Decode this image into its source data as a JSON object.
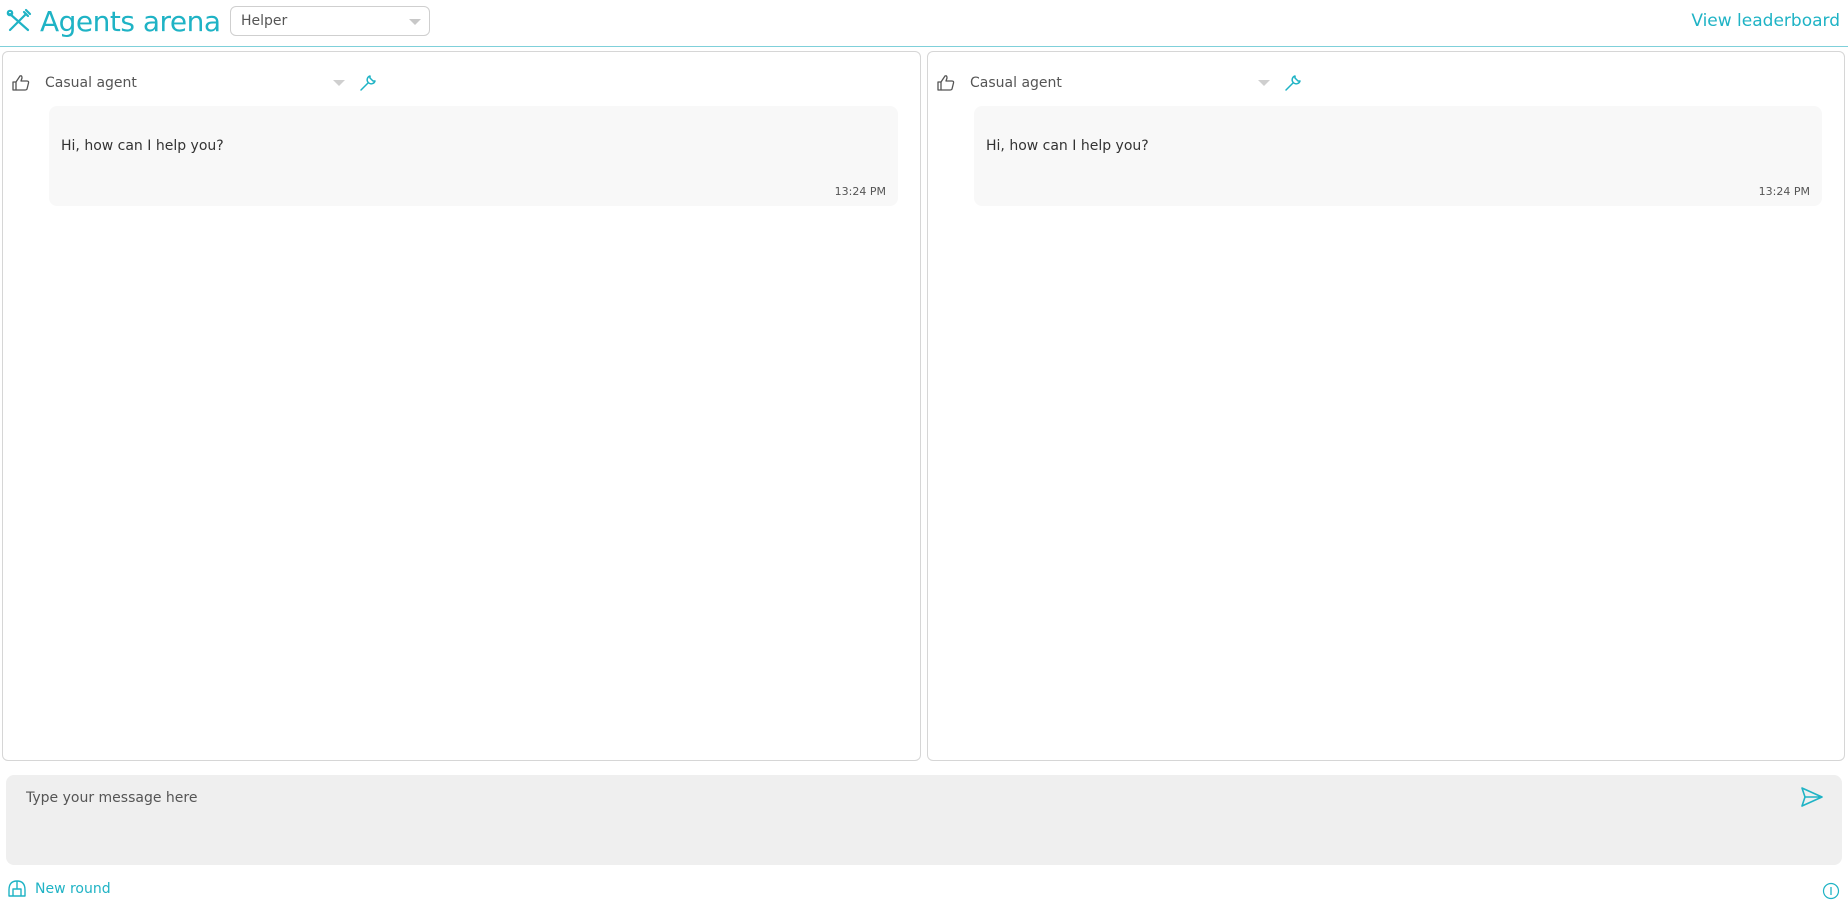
{
  "header": {
    "brand_title": "Agents arena",
    "brand_icon": "crossed-tools-icon",
    "agent_select_value": "Helper",
    "leaderboard_link": "View leaderboard"
  },
  "panels": [
    {
      "model_name": "Casual agent",
      "messages": [
        {
          "text": "Hi, how can I help you?",
          "time": "13:24 PM"
        }
      ]
    },
    {
      "model_name": "Casual agent",
      "messages": [
        {
          "text": "Hi, how can I help you?",
          "time": "13:24 PM"
        }
      ]
    }
  ],
  "composer": {
    "placeholder": "Type your message here",
    "value": ""
  },
  "footer": {
    "new_round_label": "New round"
  },
  "colors": {
    "accent": "#1fb3c5",
    "panel_border": "#d6d6d6",
    "composer_bg": "#efefef",
    "message_bg": "#f8f8f8"
  },
  "icons": {
    "brand": "crossed-tools-icon",
    "thumb": "thumbs-up-icon",
    "tool": "wrench-icon",
    "send": "send-icon",
    "new_round": "helmet-icon",
    "info": "info-icon"
  }
}
